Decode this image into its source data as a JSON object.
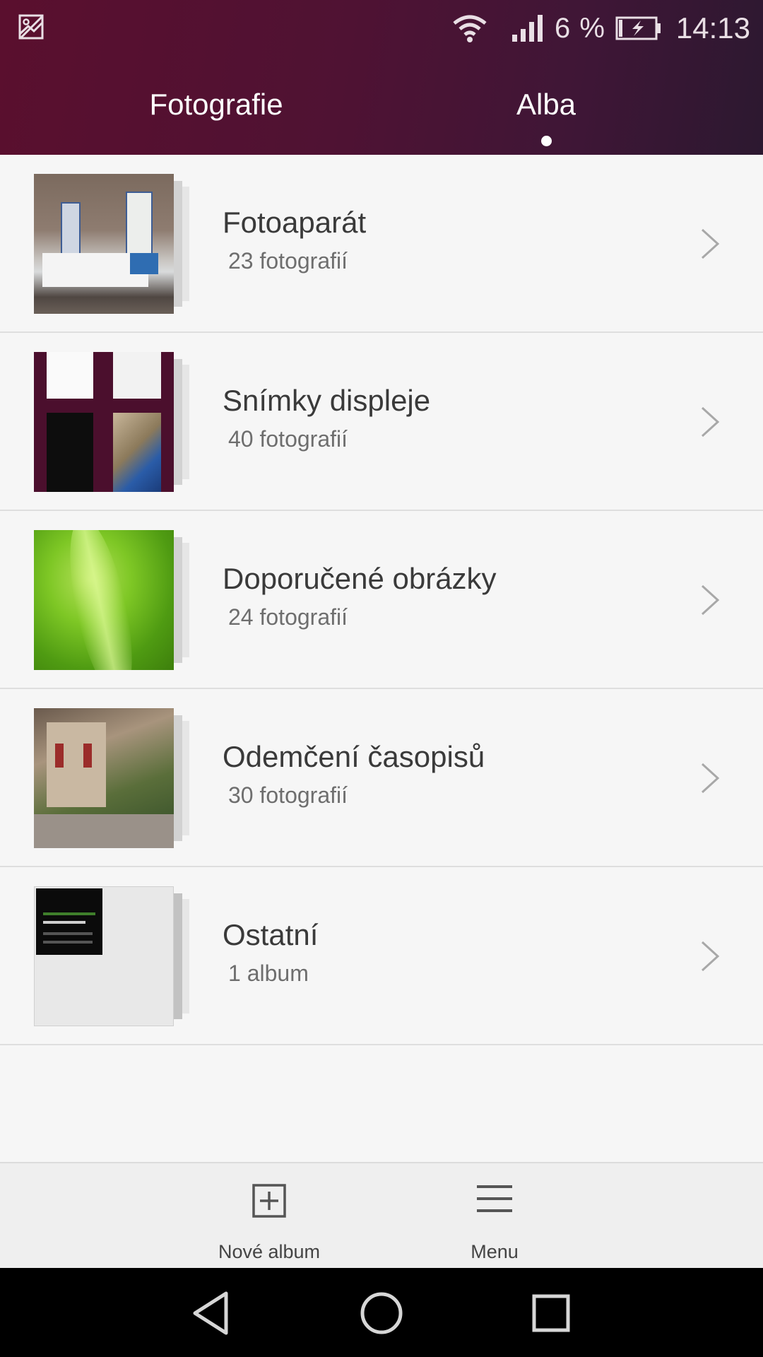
{
  "status_bar": {
    "battery_percent": "6 %",
    "time": "14:13",
    "icons": [
      "image-notification-icon",
      "wifi-icon",
      "signal-icon",
      "battery-charging-icon"
    ]
  },
  "tabs": [
    {
      "label": "Fotografie",
      "active": false
    },
    {
      "label": "Alba",
      "active": true
    }
  ],
  "albums": [
    {
      "name": "Fotoaparát",
      "count": "23 fotografií"
    },
    {
      "name": "Snímky displeje",
      "count": "40 fotografií"
    },
    {
      "name": "Doporučené obrázky",
      "count": "24 fotografií"
    },
    {
      "name": "Odemčení časopisů",
      "count": "30 fotografií"
    },
    {
      "name": "Ostatní",
      "count": "1 album"
    }
  ],
  "toolbar": {
    "new_album_label": "Nové album",
    "menu_label": "Menu"
  },
  "colors": {
    "header_accent": "#4f1233",
    "background": "#f6f6f6"
  }
}
